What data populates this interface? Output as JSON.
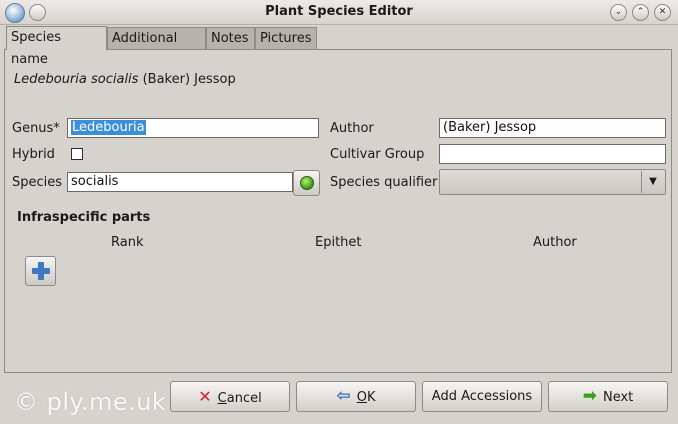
{
  "window": {
    "title": "Plant Species Editor",
    "buttons": {
      "minimize": "⌄",
      "maximize": "⌃",
      "close": "✕"
    }
  },
  "tabs": [
    {
      "label": "Species name",
      "active": true
    },
    {
      "label": "Additional info",
      "active": false
    },
    {
      "label": "Notes",
      "active": false
    },
    {
      "label": "Pictures",
      "active": false
    }
  ],
  "species_heading": {
    "italic": "Ledebouria socialis",
    "rest": " (Baker) Jessop"
  },
  "form": {
    "genus_label": "Genus",
    "genus_required_mark": "*",
    "genus_value": "Ledebouria",
    "hybrid_label": "Hybrid",
    "hybrid_checked": false,
    "species_label": "Species",
    "species_value": "socialis",
    "author_label": "Author",
    "author_value": "(Baker) Jessop",
    "cultivar_group_label": "Cultivar Group",
    "cultivar_group_value": "",
    "species_qualifier_label": "Species qualifier",
    "species_qualifier_value": ""
  },
  "infraspecific": {
    "title": "Infraspecific parts",
    "columns": [
      "Rank",
      "Epithet",
      "Author"
    ]
  },
  "buttons": {
    "cancel": {
      "mnemonic": "C",
      "rest": "ancel"
    },
    "ok": {
      "mnemonic": "O",
      "rest": "K"
    },
    "add_accessions": "Add Accessions",
    "next": "Next"
  },
  "watermark": "© ply.me.uk",
  "colors": {
    "selection": "#3b8ed8",
    "add_icon": "#3d78c0",
    "ok_dot": "#4ea419",
    "cancel_icon": "#d0202a",
    "next_icon": "#3aa21a"
  }
}
